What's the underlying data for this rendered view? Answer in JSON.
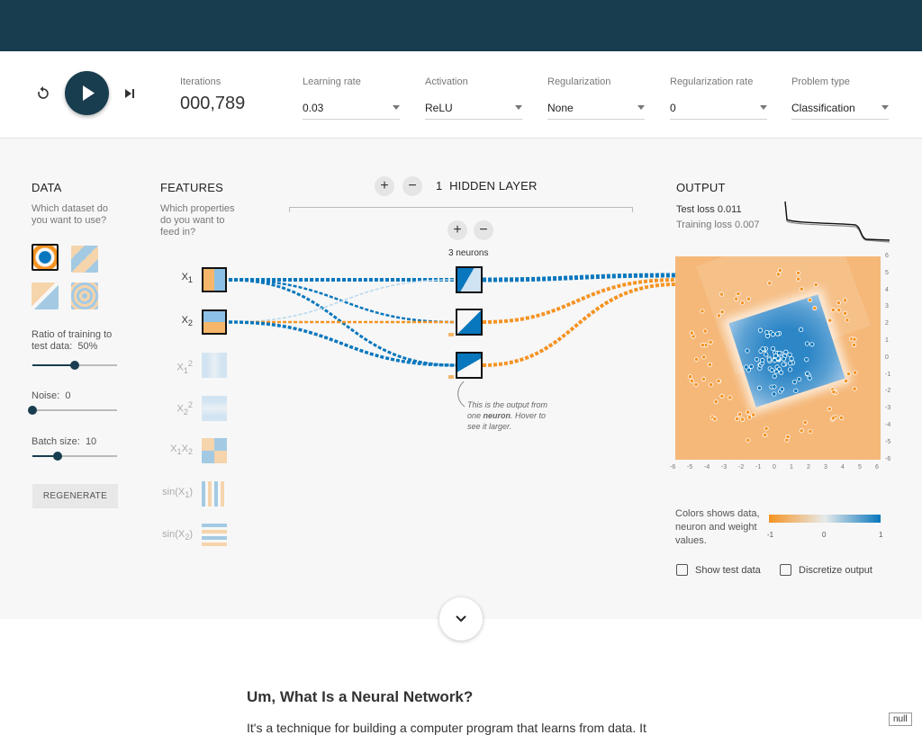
{
  "toolbar": {
    "iterations_label": "Iterations",
    "iterations_value": "000,789",
    "selects": [
      {
        "label": "Learning rate",
        "value": "0.03"
      },
      {
        "label": "Activation",
        "value": "ReLU"
      },
      {
        "label": "Regularization",
        "value": "None"
      },
      {
        "label": "Regularization rate",
        "value": "0"
      },
      {
        "label": "Problem type",
        "value": "Classification"
      }
    ]
  },
  "data_panel": {
    "title": "DATA",
    "question": "Which dataset do you want to use?",
    "ratio_label": "Ratio of training to test data:",
    "ratio_value": "50%",
    "ratio_level": 0.5,
    "noise_label": "Noise:",
    "noise_value": "0",
    "noise_level": 0,
    "batch_label": "Batch size:",
    "batch_value": "10",
    "batch_level": 0.3,
    "regenerate": "REGENERATE"
  },
  "features_panel": {
    "title": "FEATURES",
    "question": "Which properties do you want to feed in?",
    "features": [
      {
        "base": "X",
        "sub": "1",
        "sup": "",
        "active": true
      },
      {
        "base": "X",
        "sub": "2",
        "sup": "",
        "active": true
      },
      {
        "base": "X",
        "sub": "1",
        "sup": "2",
        "active": false
      },
      {
        "base": "X",
        "sub": "2",
        "sup": "2",
        "active": false
      },
      {
        "base": "X",
        "sub": "1",
        "base2": "X",
        "sub2": "2",
        "active": false
      },
      {
        "base": "sin(X",
        "sub": "1",
        "tail": ")",
        "active": false
      },
      {
        "base": "sin(X",
        "sub": "2",
        "tail": ")",
        "active": false
      }
    ]
  },
  "network": {
    "plus": "+",
    "minus": "−",
    "layer_count": "1",
    "layer_label": "HIDDEN LAYER",
    "neurons_label": "3 neurons",
    "note_pre": "This is the output from one ",
    "note_bold": "neuron",
    "note_post": ". Hover to see it larger."
  },
  "output_panel": {
    "title": "OUTPUT",
    "test_loss_label": "Test loss",
    "test_loss_value": "0.011",
    "train_loss_label": "Training loss",
    "train_loss_value": "0.007",
    "y_ticks": [
      "6",
      "5",
      "4",
      "3",
      "2",
      "1",
      "0",
      "-1",
      "-2",
      "-3",
      "-4",
      "-5",
      "-6"
    ],
    "x_ticks": [
      "-6",
      "-5",
      "-4",
      "-3",
      "-2",
      "-1",
      "0",
      "1",
      "2",
      "3",
      "4",
      "5",
      "6"
    ],
    "legend_text": "Colors shows data, neuron and weight values.",
    "legend_ticks": [
      "-1",
      "0",
      "1"
    ],
    "show_test": "Show test data",
    "discretize": "Discretize output"
  },
  "article": {
    "title": "Um, What Is a Neural Network?",
    "text": "It's a technique for building a computer program that learns from data. It"
  },
  "badge": "null",
  "colors": {
    "orange": "#f59322",
    "blue": "#0877bd",
    "navy": "#183d4e"
  }
}
